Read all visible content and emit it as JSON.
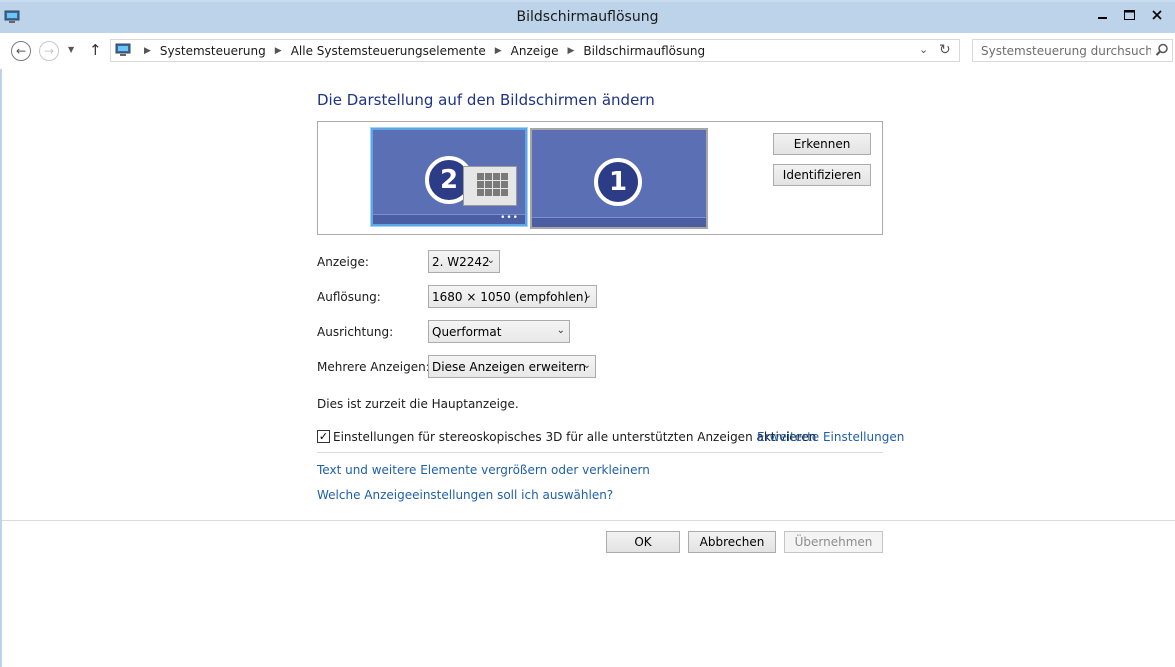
{
  "window": {
    "title": "Bildschirmauflösung"
  },
  "address_bar": {
    "breadcrumbs": [
      "Systemsteuerung",
      "Alle Systemsteuerungselemente",
      "Anzeige",
      "Bildschirmauflösung"
    ]
  },
  "search": {
    "placeholder": "Systemsteuerung durchsuchen"
  },
  "main": {
    "heading": "Die Darstellung auf den Bildschirmen ändern",
    "monitors": [
      {
        "number": "2",
        "selected": true,
        "shows_start_screen": true,
        "dots": "•••"
      },
      {
        "number": "1",
        "selected": false
      }
    ],
    "detect_button": "Erkennen",
    "identify_button": "Identifizieren",
    "display_label": "Anzeige:",
    "display_value": "2. W2242",
    "resolution_label": "Auflösung:",
    "resolution_value": "1680 × 1050 (empfohlen)",
    "orientation_label": "Ausrichtung:",
    "orientation_value": "Querformat",
    "multiple_label": "Mehrere Anzeigen:",
    "multiple_value": "Diese Anzeigen erweitern",
    "primary_info": "Dies ist zurzeit die Hauptanzeige.",
    "stereo_checkbox_label": "Einstellungen für stereoskopisches 3D für alle unterstützten Anzeigen aktivieren",
    "stereo_checked": true,
    "advanced_link": "Erweiterte Einstellungen",
    "link_text_size": "Text und weitere Elemente vergrößern oder verkleinern",
    "link_which_settings": "Welche Anzeigeeinstellungen soll ich auswählen?"
  },
  "footer": {
    "ok": "OK",
    "cancel": "Abbrechen",
    "apply": "Übernehmen",
    "apply_enabled": false
  },
  "colors": {
    "titlebar": "#bcd3ea",
    "heading": "#1e3287",
    "link": "#1f5fa8",
    "monitor_fill": "#5b6fb5",
    "monitor_selected_border": "#5aa9e6"
  }
}
